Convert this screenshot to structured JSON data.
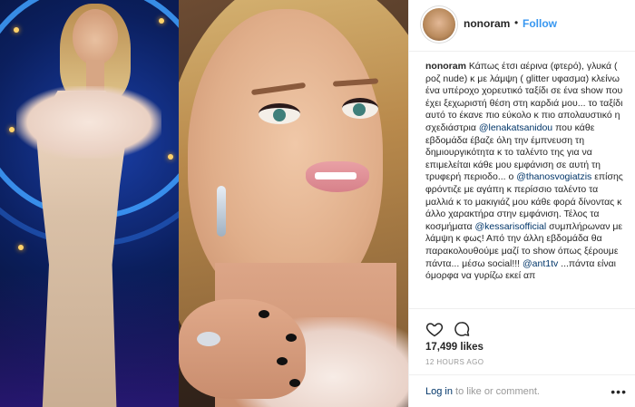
{
  "post": {
    "username": "nonoram",
    "separator": "•",
    "follow_label": "Follow",
    "caption_username": "nonoram",
    "caption_parts": [
      {
        "type": "text",
        "v": " Κάπως έτσι αέρινα (φτερό), γλυκά ( ροζ nude) κ με λάμψη ( glitter υφασμα) κλείνω ένα υπέροχο χορευτικό ταξίδι σε ένα show που έχει ξεχωριστή θέση στη καρδιά μου... το ταξίδι αυτό το έκανε πιο εύκολο κ πιο απολαυστικό η σχεδιάστρια "
      },
      {
        "type": "mention",
        "v": "@lenakatsanidou"
      },
      {
        "type": "text",
        "v": " που κάθε εβδομάδα έβαζε όλη την έμπνευση τη δημιουργικότητα κ το ταλέντο της για να επιμελείται κάθε μου εμφάνιση σε αυτή τη τρυφερή περιοδο... ο "
      },
      {
        "type": "mention",
        "v": "@thanosvogiatzis"
      },
      {
        "type": "text",
        "v": " επίσης φρόντιζε με αγάπη κ περίσσιο ταλέντο τα μαλλιά κ το μακιγιάζ μου κάθε φορά δίνοντας κ άλλο χαρακτήρα στην εμφάνιση. Τέλος τα κοσμήματα "
      },
      {
        "type": "mention",
        "v": "@kessarisofficial"
      },
      {
        "type": "text",
        "v": " συμπλήρωναν με λάμψη κ φως! Από την άλλη εβδομάδα θα παρακολουθούμε μαζί το show όπως ξέρουμε πάντα... μέσω social!!! "
      },
      {
        "type": "mention",
        "v": "@ant1tv"
      },
      {
        "type": "text",
        "v": " ...πάντα είναι όμορφα να γυρίζω εκεί απ"
      }
    ],
    "likes": "17,499 likes",
    "time_ago": "12 HOURS AGO",
    "login_link": "Log in",
    "login_rest": " to like or comment.",
    "more_label": "•••"
  },
  "colors": {
    "link_blue": "#3897f0",
    "mention": "#003569",
    "text": "#262626",
    "muted": "#999999"
  },
  "icons": [
    "heart-icon",
    "comment-icon",
    "more-options-icon"
  ]
}
